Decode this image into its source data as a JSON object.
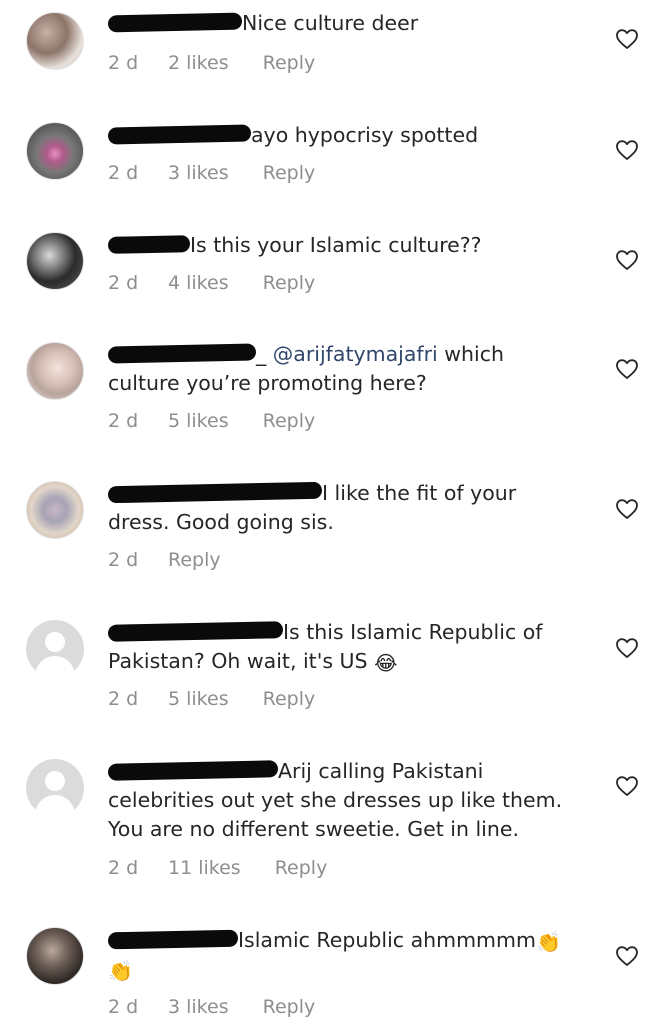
{
  "comments": [
    {
      "text": "Nice culture deer",
      "time": "2 d",
      "likes": "2 likes",
      "reply": "Reply"
    },
    {
      "text": "ayo hypocrisy spotted",
      "time": "2 d",
      "likes": "3 likes",
      "reply": "Reply"
    },
    {
      "text": "Is this your Islamic culture??",
      "time": "2 d",
      "likes": "4 likes",
      "reply": "Reply"
    },
    {
      "username_suffix": "_",
      "mention": "@arijfatymajafri",
      "text": " which",
      "text_line2": "culture you’re promoting here?",
      "time": "2 d",
      "likes": "5 likes",
      "reply": "Reply"
    },
    {
      "text": "I like the fit of your",
      "text_line2": "dress. Good going sis.",
      "time": "2 d",
      "reply": "Reply"
    },
    {
      "text": "Is this Islamic Republic of",
      "text_line2": "Pakistan? Oh wait, it's US ",
      "emoji": "😂",
      "time": "2 d",
      "likes": "5 likes",
      "reply": "Reply"
    },
    {
      "text": "Arij calling Pakistani",
      "text_line2": "celebrities out yet she dresses up like them.",
      "text_line3": "You are no different sweetie. Get in line.",
      "time": "2 d",
      "likes": "11 likes",
      "reply": "Reply"
    },
    {
      "text": "Islamic Republic ahmmmmm",
      "emoji": "👏",
      "emoji_line2": "👏",
      "time": "2 d",
      "likes": "3 likes",
      "reply": "Reply"
    }
  ],
  "icons": {
    "like": "heart-outline-icon",
    "default_avatar": "default-avatar-icon"
  },
  "colors": {
    "text": "#262626",
    "meta": "#8e8e8e",
    "mention": "#32466b",
    "redaction": "#0a0a0a"
  }
}
